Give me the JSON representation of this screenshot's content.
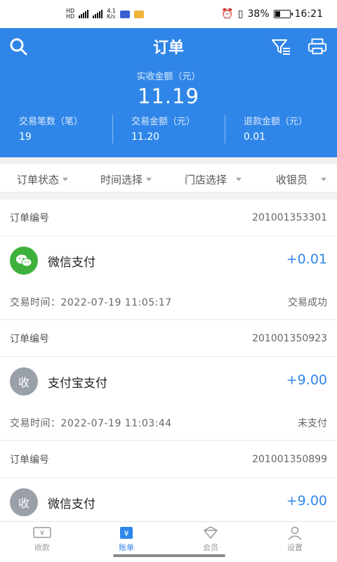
{
  "status_bar": {
    "net_top": "HD",
    "net_bottom": "HD",
    "speed": "4.1",
    "speed_unit": "K/s",
    "battery": "38%",
    "time": "16:21",
    "battery_level": 0.38
  },
  "header": {
    "title": "订单",
    "amount_label": "实收金额（元）",
    "amount_value": "11.19",
    "stats": [
      {
        "label": "交易笔数（笔）",
        "value": "19"
      },
      {
        "label": "交易金额（元）",
        "value": "11.20"
      },
      {
        "label": "退款金额（元）",
        "value": "0.01"
      }
    ]
  },
  "filters": [
    "订单状态",
    "时间选择",
    "门店选择",
    "收银员"
  ],
  "orders": [
    {
      "order_label": "订单编号",
      "order_no": "201001353301",
      "icon": "wechat-pay-icon",
      "method": "微信支付",
      "amount": "+0.01",
      "time_label": "交易时间：",
      "time": "2022-07-19 11:05:17",
      "status": "交易成功"
    },
    {
      "order_label": "订单编号",
      "order_no": "201001350923",
      "icon": "receipt-icon",
      "icon_text": "收",
      "method": "支付宝支付",
      "amount": "+9.00",
      "time_label": "交易时间：",
      "time": "2022-07-19 11:03:44",
      "status": "未支付"
    },
    {
      "order_label": "订单编号",
      "order_no": "201001350899",
      "icon": "receipt-icon",
      "icon_text": "收",
      "method": "微信支付",
      "amount": "+9.00"
    }
  ],
  "tabs": [
    {
      "label": "收款",
      "icon": "yen-cash-icon"
    },
    {
      "label": "账单",
      "icon": "bill-icon"
    },
    {
      "label": "会员",
      "icon": "member-icon"
    },
    {
      "label": "设置",
      "icon": "user-settings-icon"
    }
  ],
  "colors": {
    "primary": "#2f86e8",
    "wechat": "#3eb13c",
    "inactive_icon": "#9aa0a8"
  }
}
